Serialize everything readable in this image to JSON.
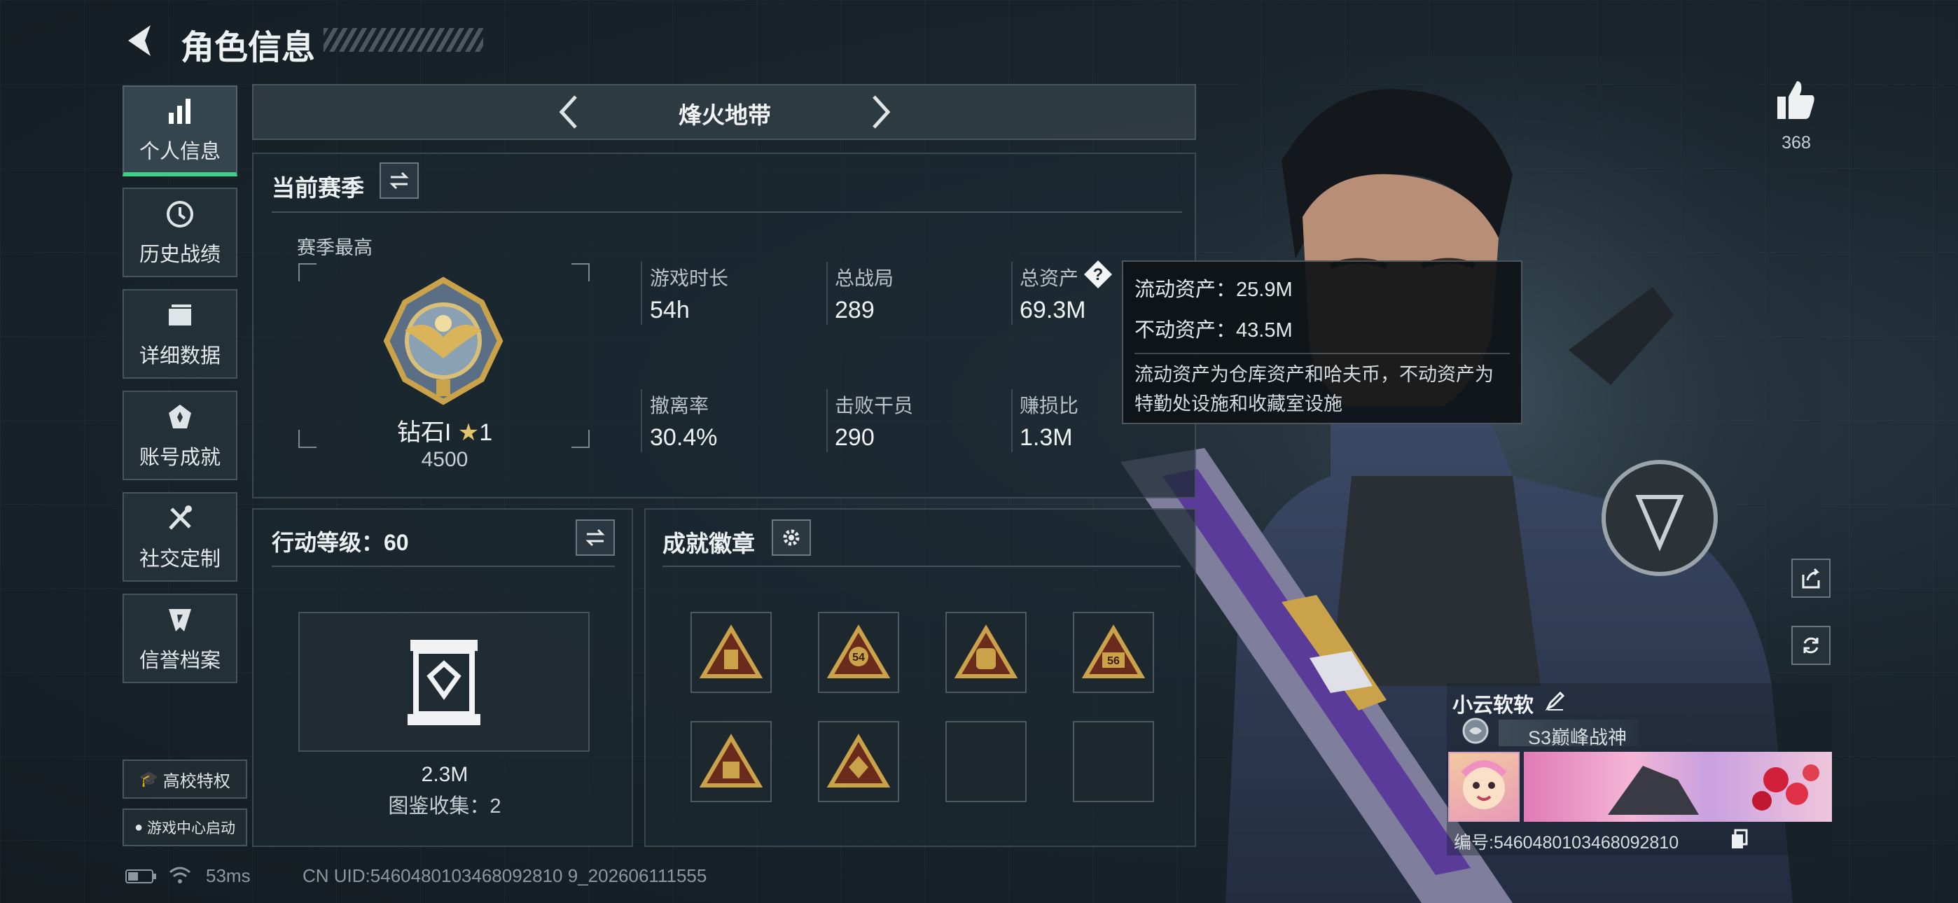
{
  "header": {
    "title": "角色信息"
  },
  "nav": [
    {
      "label": "个人信息",
      "icon": "bar-chart-icon"
    },
    {
      "label": "历史战绩",
      "icon": "history-clock-icon"
    },
    {
      "label": "详细数据",
      "icon": "folder-icon"
    },
    {
      "label": "账号成就",
      "icon": "medal-icon"
    },
    {
      "label": "社交定制",
      "icon": "tools-icon"
    },
    {
      "label": "信誉档案",
      "icon": "shield-check-icon"
    }
  ],
  "bottom_left": {
    "campus": "高校特权",
    "game_center": "游戏中心启动"
  },
  "mode_selector": {
    "label": "烽火地带"
  },
  "season": {
    "title": "当前赛季",
    "best_label": "赛季最高",
    "rank_name": "钻石I",
    "rank_stars": "1",
    "rank_score": "4500",
    "stats": [
      {
        "label": "游戏时长",
        "value": "54h"
      },
      {
        "label": "总战局",
        "value": "289"
      },
      {
        "label": "总资产",
        "value": "69.3M"
      },
      {
        "label": "撤离率",
        "value": "30.4%"
      },
      {
        "label": "击败干员",
        "value": "290"
      },
      {
        "label": "赚损比",
        "value": "1.3M"
      }
    ]
  },
  "tooltip": {
    "liquid": "流动资产：25.9M",
    "fixed": "不动资产：43.5M",
    "desc": "流动资产为仓库资产和哈夫币，不动资产为特勤处设施和收藏室设施"
  },
  "action_level": {
    "title": "行动等级：60",
    "collection_value": "2.3M",
    "collection_label": "图鉴收集：2"
  },
  "achievements": {
    "title": "成就徽章",
    "badges": [
      "",
      "54",
      "",
      "56",
      "",
      ""
    ]
  },
  "likes": {
    "count": "368"
  },
  "player": {
    "name": "小云软软",
    "title": "S3巅峰战神",
    "id": "编号:5460480103468092810"
  },
  "status_bar": {
    "ping": "53ms",
    "uid": "CN UID:5460480103468092810 9_202606111555"
  },
  "colors": {
    "accent_green": "#3fd18a",
    "badge_gold": "#c9a24a"
  }
}
